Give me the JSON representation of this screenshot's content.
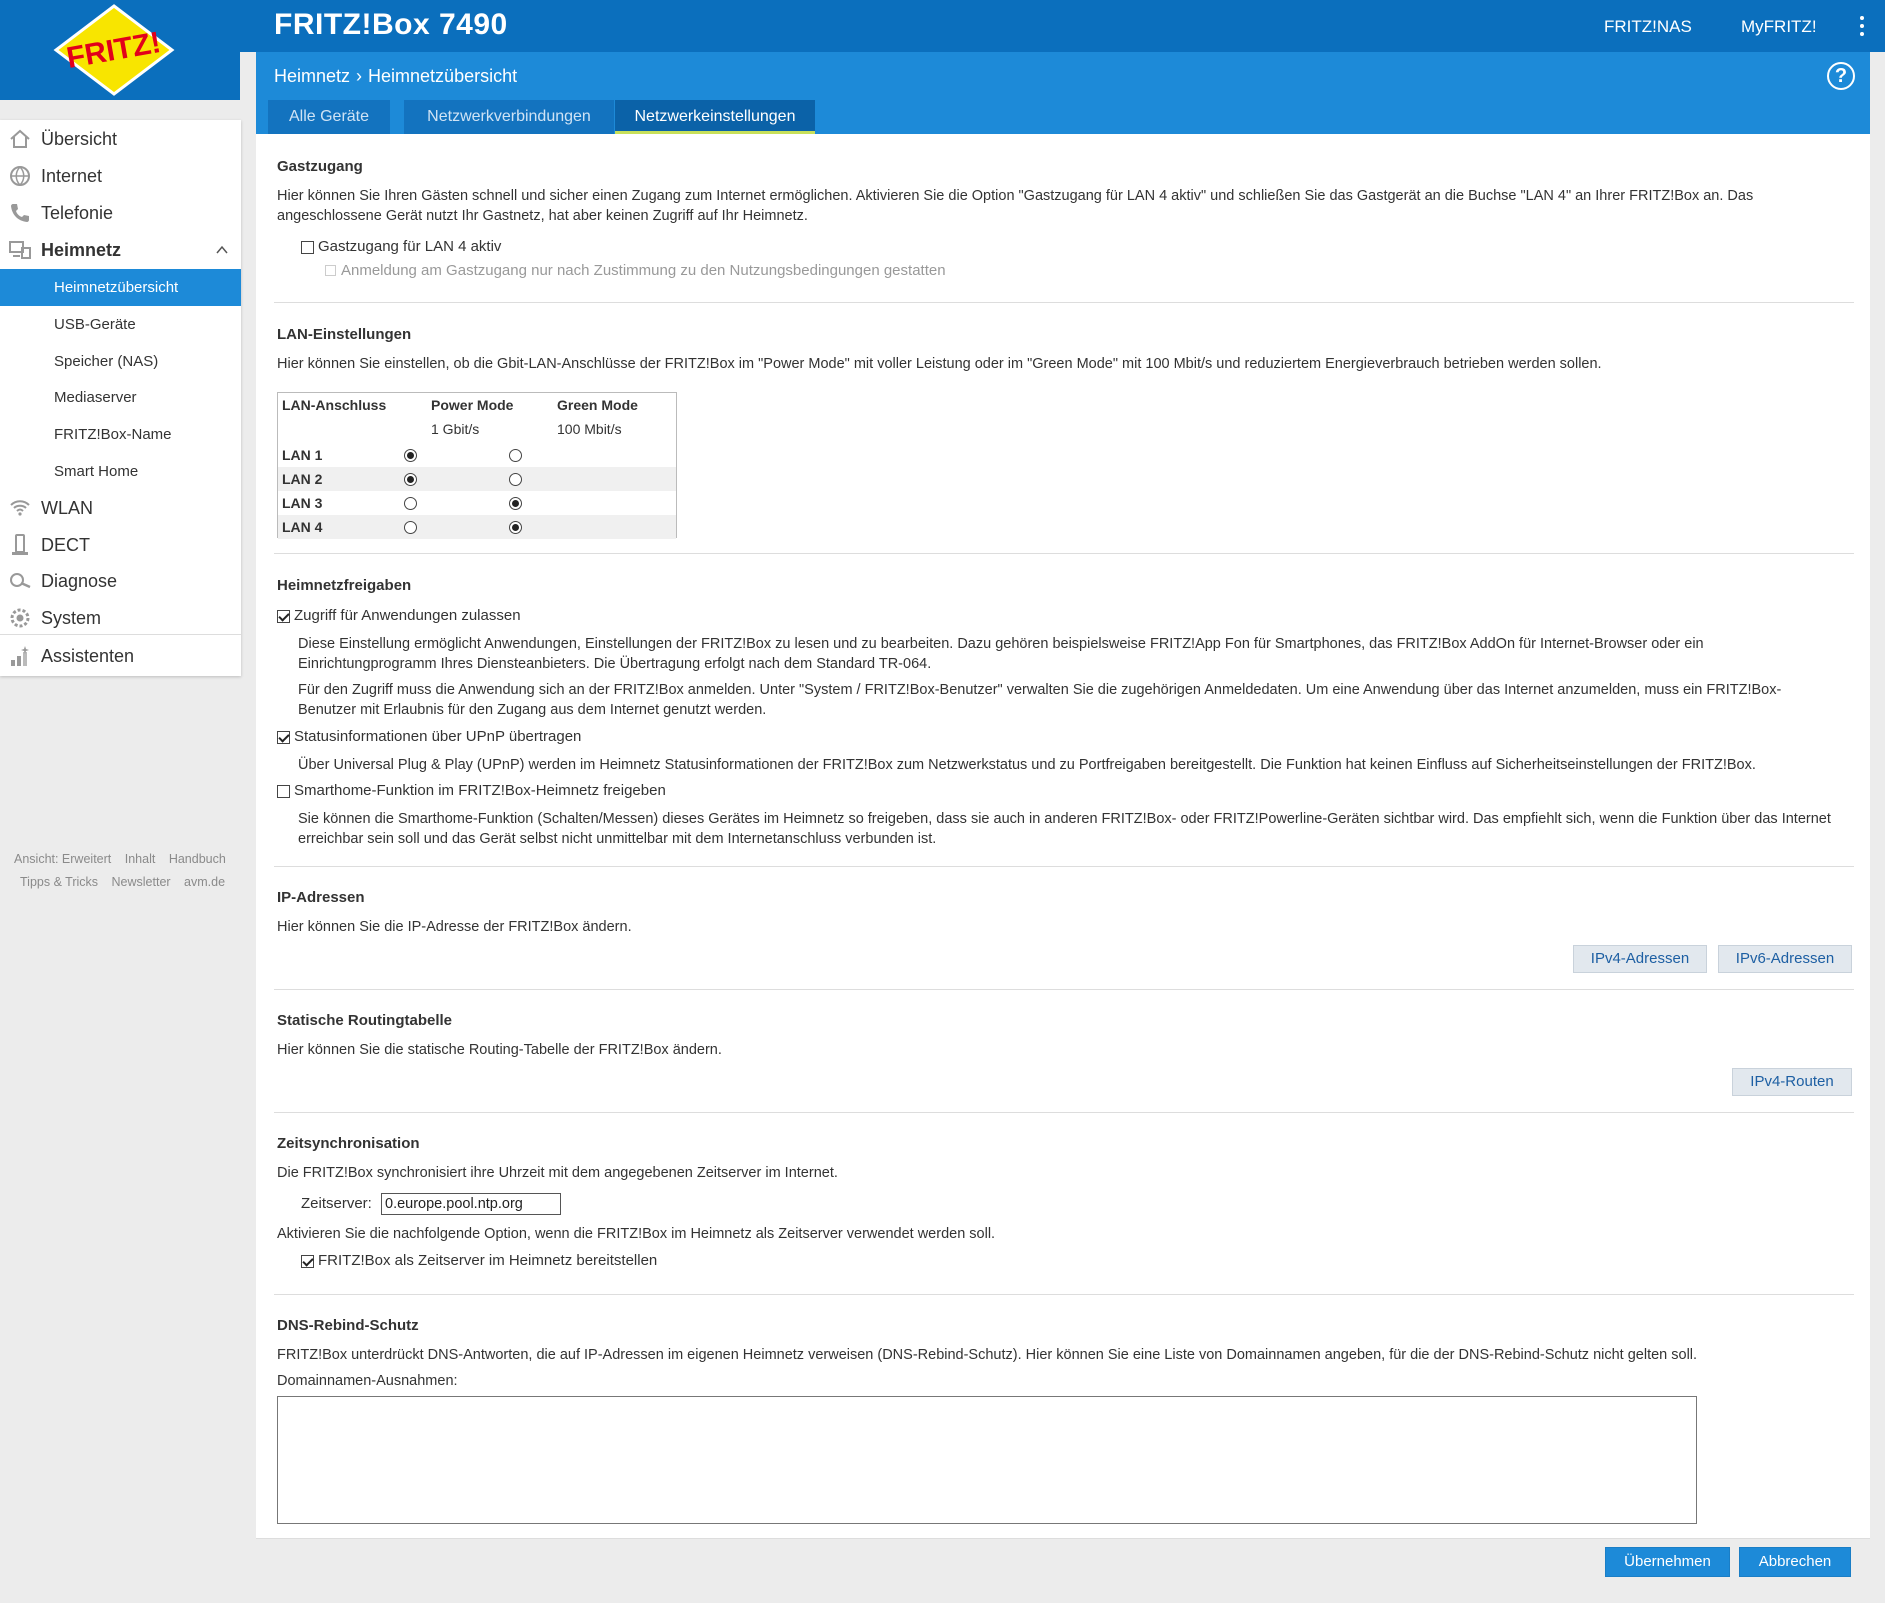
{
  "header": {
    "product": "FRITZ!Box 7490",
    "links": [
      "FRITZ!NAS",
      "MyFRITZ!"
    ],
    "logo_text": "FRITZ!"
  },
  "breadcrumb": {
    "parent": "Heimnetz",
    "current": "Heimnetzübersicht"
  },
  "tabs": [
    {
      "label": "Alle Geräte"
    },
    {
      "label": "Netzwerkverbindungen"
    },
    {
      "label": "Netzwerkeinstellungen",
      "active": true
    }
  ],
  "sidebar": {
    "items": [
      {
        "label": "Übersicht",
        "icon": "home-icon"
      },
      {
        "label": "Internet",
        "icon": "globe-icon"
      },
      {
        "label": "Telefonie",
        "icon": "phone-icon"
      },
      {
        "label": "Heimnetz",
        "icon": "network-icon",
        "expanded": true
      },
      {
        "label": "WLAN",
        "icon": "wifi-icon"
      },
      {
        "label": "DECT",
        "icon": "dect-phone-icon"
      },
      {
        "label": "Diagnose",
        "icon": "magnifier-icon"
      },
      {
        "label": "System",
        "icon": "gear-icon"
      },
      {
        "label": "Assistenten",
        "icon": "wizard-icon"
      }
    ],
    "subitems": [
      "Heimnetzübersicht",
      "USB-Geräte",
      "Speicher (NAS)",
      "Mediaserver",
      "FRITZ!Box-Name",
      "Smart Home"
    ],
    "footer_links": [
      "Ansicht: Erweitert",
      "Inhalt",
      "Handbuch",
      "Tipps & Tricks",
      "Newsletter",
      "avm.de"
    ]
  },
  "gast": {
    "title": "Gastzugang",
    "text": "Hier können Sie Ihren Gästen schnell und sicher einen Zugang zum Internet ermöglichen. Aktivieren Sie die Option \"Gastzugang für LAN 4 aktiv\" und schließen Sie das Gastgerät an die Buchse \"LAN 4\" an Ihrer FRITZ!Box an. Das angeschlossene Gerät nutzt Ihr Gastnetz, hat aber keinen Zugriff auf Ihr Heimnetz.",
    "cb1": "Gastzugang für LAN 4 aktiv",
    "cb2": "Anmeldung am Gastzugang nur nach Zustimmung zu den Nutzungsbedingungen gestatten"
  },
  "lan": {
    "title": "LAN-Einstellungen",
    "text": "Hier können Sie einstellen, ob die Gbit-LAN-Anschlüsse der FRITZ!Box im \"Power Mode\" mit voller Leistung oder im \"Green Mode\" mit 100 Mbit/s und reduziertem Energieverbrauch betrieben werden sollen.",
    "col1": "LAN-Anschluss",
    "col2": "Power Mode",
    "col2sub": "1 Gbit/s",
    "col3": "Green Mode",
    "col3sub": "100 Mbit/s",
    "rows": [
      {
        "name": "LAN 1",
        "mode": "power"
      },
      {
        "name": "LAN 2",
        "mode": "power"
      },
      {
        "name": "LAN 3",
        "mode": "green"
      },
      {
        "name": "LAN 4",
        "mode": "green"
      }
    ]
  },
  "freigaben": {
    "title": "Heimnetzfreigaben",
    "cb1": "Zugriff für Anwendungen zulassen",
    "p1": "Diese Einstellung ermöglicht Anwendungen, Einstellungen der FRITZ!Box zu lesen und zu bearbeiten. Dazu gehören beispielsweise FRITZ!App Fon für Smartphones, das FRITZ!Box AddOn für Internet-Browser oder ein Einrichtungprogramm Ihres Diensteanbieters. Die Übertragung erfolgt nach dem Standard TR-064.",
    "p2": "Für den Zugriff muss die Anwendung sich an der FRITZ!Box anmelden. Unter \"System / FRITZ!Box-Benutzer\" verwalten Sie die zugehörigen Anmeldedaten. Um eine Anwendung über das Internet anzumelden, muss ein FRITZ!Box-Benutzer mit Erlaubnis für den Zugang aus dem Internet genutzt werden.",
    "cb2": "Statusinformationen über UPnP übertragen",
    "p3": "Über Universal Plug & Play (UPnP) werden im Heimnetz Statusinformationen der FRITZ!Box zum Netzwerkstatus und zu Portfreigaben bereitgestellt. Die Funktion hat keinen Einfluss auf Sicherheitseinstellungen der FRITZ!Box.",
    "cb3": "Smarthome-Funktion im FRITZ!Box-Heimnetz freigeben",
    "p4": "Sie können die Smarthome-Funktion (Schalten/Messen) dieses Gerätes im Heimnetz so freigeben, dass sie auch in anderen FRITZ!Box- oder FRITZ!Powerline-Geräten sichtbar wird. Das empfiehlt sich, wenn die Funktion über das Internet erreichbar sein soll und das Gerät selbst nicht unmittelbar mit dem Internetanschluss verbunden ist."
  },
  "ip": {
    "title": "IP-Adressen",
    "text": "Hier können Sie die IP-Adresse der FRITZ!Box ändern.",
    "btn_v4": "IPv4-Adressen",
    "btn_v6": "IPv6-Adressen"
  },
  "routing": {
    "title": "Statische Routingtabelle",
    "text": "Hier können Sie die statische Routing-Tabelle der FRITZ!Box ändern.",
    "btn": "IPv4-Routen"
  },
  "zeit": {
    "title": "Zeitsynchronisation",
    "text": "Die FRITZ!Box synchronisiert ihre Uhrzeit mit dem angegebenen Zeitserver im Internet.",
    "label": "Zeitserver:",
    "value": "0.europe.pool.ntp.org",
    "text2": "Aktivieren Sie die nachfolgende Option, wenn die FRITZ!Box im Heimnetz als Zeitserver verwendet werden soll.",
    "cb": "FRITZ!Box als Zeitserver im Heimnetz bereitstellen"
  },
  "dns": {
    "title": "DNS-Rebind-Schutz",
    "text": "FRITZ!Box unterdrückt DNS-Antworten, die auf IP-Adressen im eigenen Heimnetz verweisen (DNS-Rebind-Schutz). Hier können Sie eine Liste von Domainnamen angeben, für die der DNS-Rebind-Schutz nicht gelten soll.",
    "label": "Domainnamen-Ausnahmen:"
  },
  "actions": {
    "apply": "Übernehmen",
    "cancel": "Abbrechen"
  },
  "colors": {
    "brand_blue": "#0b6fbd",
    "band_blue": "#1d8ad8",
    "tab_accent": "#c8e05a",
    "logo_red": "#e2001a",
    "logo_yellow": "#f8e500"
  }
}
